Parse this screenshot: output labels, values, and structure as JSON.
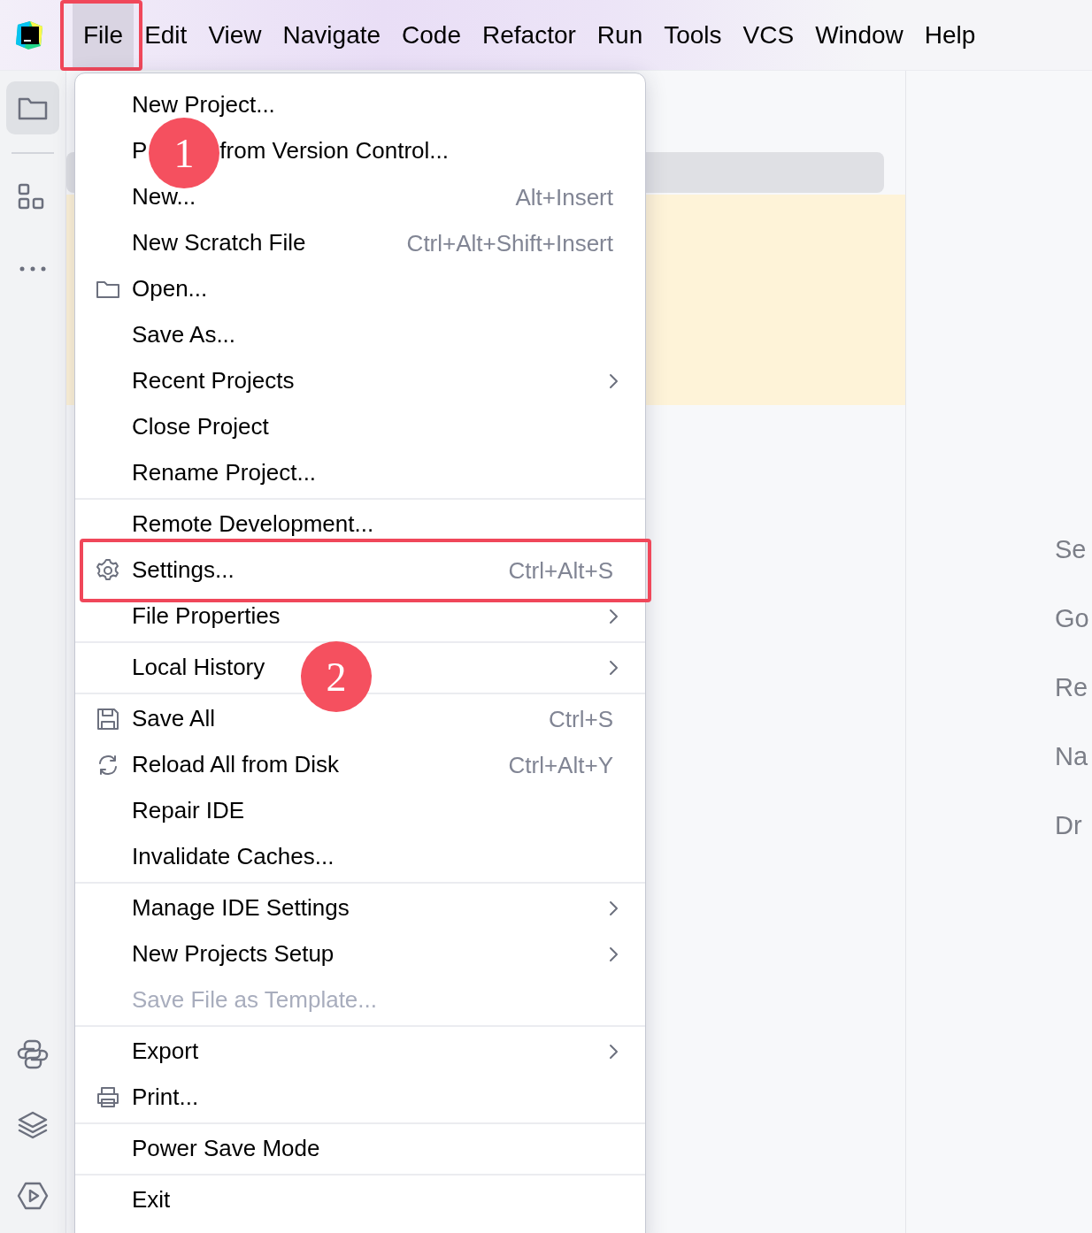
{
  "menu_bar": {
    "items": [
      {
        "label": "File",
        "selected": true,
        "annotated": true
      },
      {
        "label": "Edit",
        "selected": false,
        "annotated": false
      },
      {
        "label": "View",
        "selected": false,
        "annotated": false
      },
      {
        "label": "Navigate",
        "selected": false,
        "annotated": false
      },
      {
        "label": "Code",
        "selected": false,
        "annotated": false
      },
      {
        "label": "Refactor",
        "selected": false,
        "annotated": false
      },
      {
        "label": "Run",
        "selected": false,
        "annotated": false
      },
      {
        "label": "Tools",
        "selected": false,
        "annotated": false
      },
      {
        "label": "VCS",
        "selected": false,
        "annotated": false
      },
      {
        "label": "Window",
        "selected": false,
        "annotated": false
      },
      {
        "label": "Help",
        "selected": false,
        "annotated": false
      }
    ]
  },
  "left_toolbar": {
    "top": [
      {
        "selected": true
      },
      {
        "selected": false
      },
      {
        "selected": false
      }
    ],
    "bottom": [
      {
        "selected": false
      },
      {
        "selected": false
      },
      {
        "selected": false
      }
    ]
  },
  "file_menu": {
    "groups": [
      {
        "items": [
          {
            "label": "New Project..."
          },
          {
            "label": "P",
            "label_after": "from Version Control..."
          },
          {
            "label": "New...",
            "shortcut": "Alt+Insert"
          },
          {
            "label": "New Scratch File",
            "shortcut": "Ctrl+Alt+Shift+Insert"
          },
          {
            "label": "Open..."
          },
          {
            "label": "Save As..."
          },
          {
            "label": "Recent Projects",
            "submenu": true
          },
          {
            "label": "Close Project"
          },
          {
            "label": "Rename Project..."
          }
        ]
      },
      {
        "items": [
          {
            "label": "Remote Development..."
          },
          {
            "label": "Settings...",
            "shortcut": "Ctrl+Alt+S",
            "annotated": true
          },
          {
            "label": "File Properties",
            "submenu": true
          }
        ]
      },
      {
        "items": [
          {
            "label": "Local History",
            "submenu": true
          }
        ]
      },
      {
        "items": [
          {
            "label": "Save All",
            "shortcut": "Ctrl+S"
          },
          {
            "label": "Reload All from Disk",
            "shortcut": "Ctrl+Alt+Y"
          },
          {
            "label": "Repair IDE"
          },
          {
            "label": "Invalidate Caches..."
          }
        ]
      },
      {
        "items": [
          {
            "label": "Manage IDE Settings",
            "submenu": true
          },
          {
            "label": "New Projects Setup",
            "submenu": true
          },
          {
            "label": "Save File as Template...",
            "disabled": true
          }
        ]
      },
      {
        "items": [
          {
            "label": "Export",
            "submenu": true
          },
          {
            "label": "Print..."
          }
        ]
      },
      {
        "items": [
          {
            "label": "Power Save Mode"
          }
        ]
      },
      {
        "items": [
          {
            "label": "Exit"
          }
        ]
      }
    ]
  },
  "step_badges": [
    {
      "label": "1"
    },
    {
      "label": "2"
    }
  ],
  "right_pane": {
    "items": [
      "Se",
      "Go",
      "Re",
      "Na",
      "Dr"
    ]
  }
}
